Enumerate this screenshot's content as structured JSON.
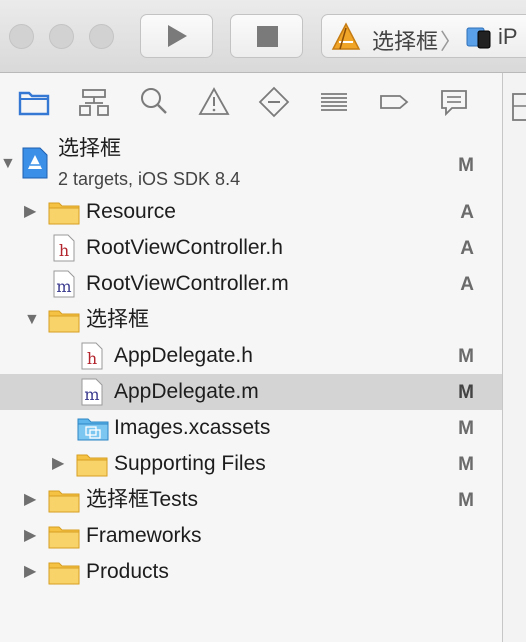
{
  "toolbar": {
    "scheme": {
      "app_name": "选择框",
      "separator": "〉",
      "device_name": "iP"
    }
  },
  "navigator_tabs": [
    {
      "icon": "folder-icon"
    },
    {
      "icon": "hierarchy-icon"
    },
    {
      "icon": "search-icon"
    },
    {
      "icon": "warning-icon"
    },
    {
      "icon": "test-icon"
    },
    {
      "icon": "debug-icon"
    },
    {
      "icon": "breakpoint-icon"
    },
    {
      "icon": "report-icon"
    }
  ],
  "project": {
    "name": "选择框",
    "subtitle": "2 targets, iOS SDK 8.4",
    "status": "M",
    "disclosure": "▼"
  },
  "tree": [
    {
      "name": "Resource",
      "status": "A",
      "icon": "folder-icon",
      "disclosure": "▶"
    },
    {
      "name": "RootViewController.h",
      "status": "A",
      "icon": "header-file-icon",
      "glyph": "h"
    },
    {
      "name": "RootViewController.m",
      "status": "A",
      "icon": "objc-file-icon",
      "glyph": "m"
    },
    {
      "name": "选择框",
      "status": "",
      "icon": "folder-icon",
      "disclosure": "▼"
    },
    {
      "name": "AppDelegate.h",
      "status": "M",
      "icon": "header-file-icon",
      "glyph": "h"
    },
    {
      "name": "AppDelegate.m",
      "status": "M",
      "icon": "objc-file-icon",
      "glyph": "m",
      "selected": true
    },
    {
      "name": "Images.xcassets",
      "status": "M",
      "icon": "asset-catalog-icon"
    },
    {
      "name": "Supporting Files",
      "status": "M",
      "icon": "folder-icon",
      "disclosure": "▶"
    },
    {
      "name": "选择框Tests",
      "status": "M",
      "icon": "folder-icon",
      "disclosure": "▶"
    },
    {
      "name": "Frameworks",
      "status": "",
      "icon": "folder-icon",
      "disclosure": "▶"
    },
    {
      "name": "Products",
      "status": "",
      "icon": "folder-icon",
      "disclosure": "▶"
    }
  ],
  "colors": {
    "accent": "#3478d4",
    "folder": "#f5c244",
    "selection": "#d4d4d4"
  }
}
